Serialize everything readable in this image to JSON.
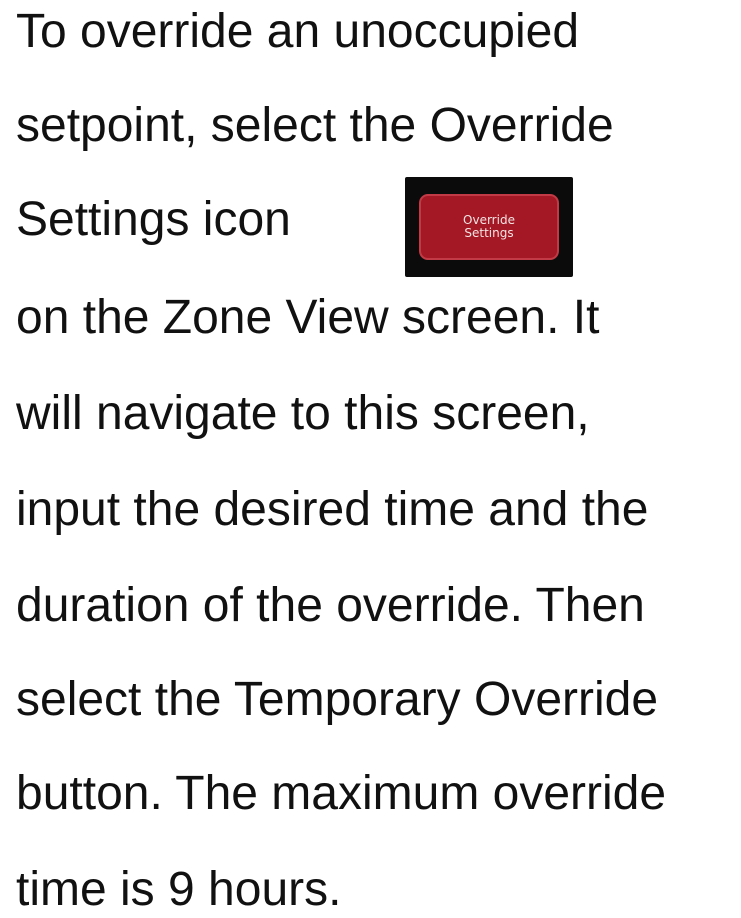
{
  "instructions": {
    "lines": [
      "To override an unoccupied",
      "setpoint, select the Override",
      "Settings icon",
      "on the Zone View screen. It",
      "will navigate to this screen,",
      "input the desired time and the",
      "duration of the override. Then",
      "select the Temporary Override",
      "button. The maximum override",
      "time is 9 hours."
    ]
  },
  "override_settings_icon": {
    "line1": "Override",
    "line2": "Settings",
    "background_color": "#a31824",
    "frame_color": "#0b0b0b"
  }
}
